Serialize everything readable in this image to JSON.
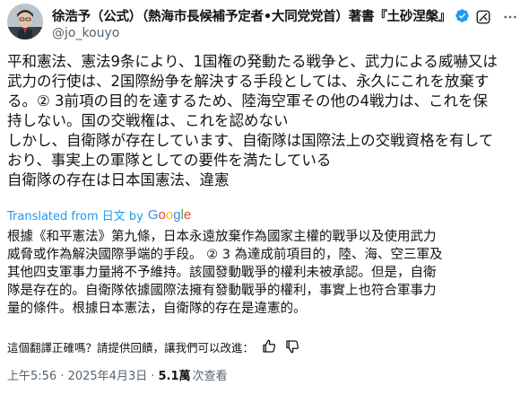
{
  "author": {
    "display_name": "徐浩予（公式）（熱海市長候補予定者•大同党党首）著書『土砂涅槃』",
    "handle": "@jo_kouyo"
  },
  "post": {
    "text_lines": [
      "平和憲法、憲法9条により、1国権の発動たる戦争と、武力による威嚇又は",
      "武力の行使は、2国際紛争を解決する手段としては、永久にこれを放棄す",
      "る。② 3前項の目的を達するため、陸海空軍その他の4戦力は、これを保",
      "持しない。国の交戦権は、これを認めない",
      "しかし、自衛隊が存在しています、自衛隊は国際法上の交戦資格を有して",
      "おり、事実上の軍隊としての要件を満たしている",
      "自衛隊の存在は日本国憲法、違憲"
    ],
    "translated_from": "Translated from 日文 by",
    "translation_provider": "Google",
    "translation_lines": [
      "根據《和平憲法》第九條，日本永遠放棄作為國家主權的戰爭以及使用武力",
      "威脅或作為解決國際爭端的手段。 ② 3 為達成前項目的，陸、海、空三軍及",
      "其他四支軍事力量將不予維持。該國發動戰爭的權利未被承認。但是，自衛",
      "隊是存在的。自衛隊依據國際法擁有發動戰爭的權利，事實上也符合軍事力",
      "量的條件。根據日本憲法，自衛隊的存在是違憲的。"
    ],
    "feedback_prompt": "這個翻譯正確嗎？請提供回饋，讓我們可以改進：",
    "timestamp": "上午5:56 · 2025年4月3日 ·",
    "views_count": "5.1萬",
    "views_label": "次查看"
  },
  "colors": {
    "accent": "#1d9bf0",
    "secondary_text": "#536471",
    "primary_text": "#0f1419"
  },
  "icons": {
    "verified": "verified-badge-icon",
    "grok": "grok-icon",
    "more": "more-horizontal-icon",
    "thumbs_up": "thumbs-up-icon",
    "thumbs_down": "thumbs-down-icon"
  }
}
